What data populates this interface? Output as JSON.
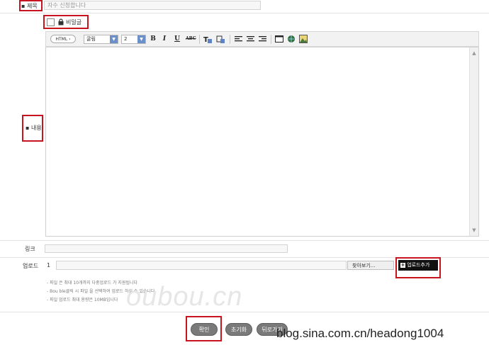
{
  "form": {
    "title_label": "제목",
    "title_value": "자수 신청합니다",
    "secret_label": "비밀글",
    "content_label": "내용",
    "link_label": "링크",
    "link_value": "",
    "upload_label": "업로드",
    "upload_index": "1",
    "browse_label": "찾아보기...",
    "add_upload_label": "업로드추가",
    "notes": [
      "- 파일 은 최대 10개까지 다중업로드 가 지원됩니다",
      "- Bou ble클릭 시 파일 을 선택하여 업로드 하실 수 있습니다",
      "- 파일 업로드 최대 용량은 10MB입니다"
    ]
  },
  "toolbar": {
    "html_label": "HTML",
    "font_value": "굴림",
    "size_value": "2",
    "bold": "B",
    "italic": "I",
    "underline": "U",
    "strike": "ABC"
  },
  "buttons": {
    "confirm": "확인",
    "reset": "초기화",
    "back": "뒤로가기"
  },
  "watermark": "blog.sina.com.cn/headong1004",
  "faint_watermark": "oubou.cn",
  "colors": {
    "highlight": "#c8141e",
    "button": "#7a7a7a",
    "select_arrow": "#6b8fc9"
  }
}
